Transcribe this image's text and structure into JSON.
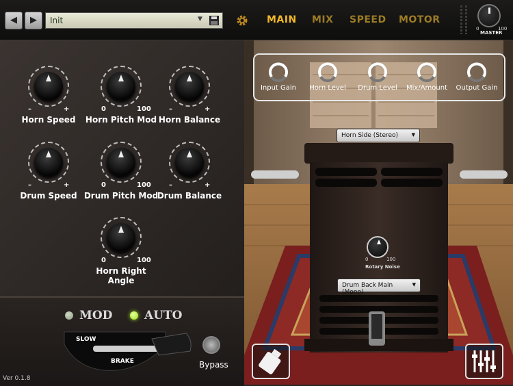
{
  "topbar": {
    "prev_icon": "arrow-left-icon",
    "next_icon": "arrow-right-icon",
    "preset_name": "Init",
    "save_icon": "floppy-disk-icon",
    "settings_icon": "gear-icon",
    "tabs": [
      {
        "label": "MAIN",
        "active": true
      },
      {
        "label": "MIX",
        "active": false
      },
      {
        "label": "SPEED",
        "active": false
      },
      {
        "label": "MOTOR",
        "active": false
      }
    ],
    "master": {
      "label": "MASTER",
      "min": "0",
      "max": "100"
    },
    "accent_color": "#f0b72a"
  },
  "knobs": [
    {
      "label": "Horn Speed",
      "min": "–",
      "max": "+"
    },
    {
      "label": "Horn Pitch Mod",
      "min": "0",
      "max": "100"
    },
    {
      "label": "Horn Balance",
      "min": "–",
      "max": "+"
    },
    {
      "label": "Drum Speed",
      "min": "–",
      "max": "+"
    },
    {
      "label": "Drum Pitch Mod",
      "min": "0",
      "max": "100"
    },
    {
      "label": "Drum Balance",
      "min": "–",
      "max": "+"
    },
    {
      "label": "Horn Right Angle",
      "min": "0",
      "max": "100"
    }
  ],
  "modes": {
    "mod_label": "MOD",
    "auto_label": "AUTO",
    "auto_active": true,
    "led_on_color": "#9be21f",
    "led_off_color": "#8f9b86"
  },
  "speed_lever": {
    "slow_label": "SLOW",
    "brake_label": "BRAKE"
  },
  "bypass": {
    "label": "Bypass"
  },
  "version": "Ver 0.1.8",
  "gains": [
    {
      "label": "Input Gain"
    },
    {
      "label": "Horn Level"
    },
    {
      "label": "Drum Level"
    },
    {
      "label": "Mix/Amount"
    },
    {
      "label": "Output Gain"
    }
  ],
  "scene": {
    "horn_mic_select": "Horn Side (Stereo)",
    "drum_mic_select": "Drum Back Main (Mono)",
    "rotary_noise": {
      "label": "Rotary Noise",
      "min": "0",
      "max": "100"
    },
    "oil_button_icon": "oil-bottle-icon",
    "mixer_button_icon": "mixer-sliders-icon"
  }
}
